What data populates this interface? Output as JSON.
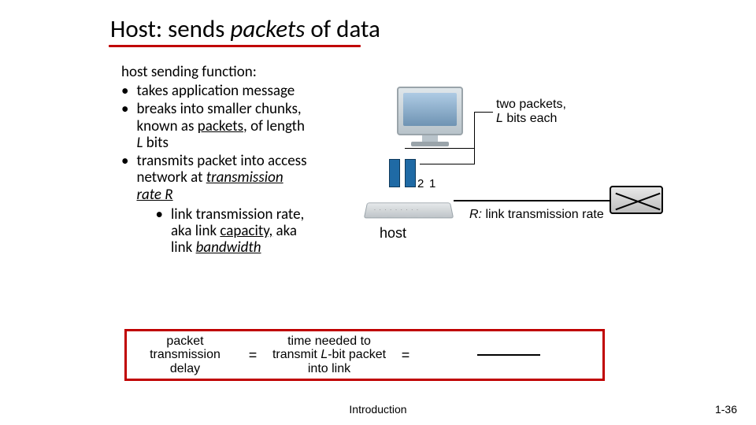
{
  "title": {
    "pre": "Host: sends ",
    "em": "packets",
    "post": " of data"
  },
  "lead": "host sending function:",
  "bullets": {
    "b1": "takes application message",
    "b2_a": "breaks into smaller chunks, known as ",
    "b2_packets": "packets",
    "b2_b": ", of length ",
    "b2_L": "L",
    "b2_c": " bits",
    "b3_a": "transmits packet into access network at ",
    "b3_tr": "transmission rate R",
    "b3_inner_a": "link transmission rate, aka link ",
    "b3_inner_cap": "capacity,",
    "b3_inner_b": " aka link ",
    "b3_inner_bw": "bandwidth"
  },
  "diagram": {
    "pkt2": "2",
    "pkt1": "1",
    "two_line1": "two packets,",
    "two_line2_pre": "",
    "two_line2_L": "L",
    "two_line2_post": " bits each",
    "host": "host",
    "R": "R:",
    "R_text": " link transmission rate"
  },
  "formula": {
    "col1": "packet transmission delay",
    "eq": "=",
    "col2_pre": "time needed to transmit ",
    "col2_L": "L",
    "col2_post": "-bit packet into link"
  },
  "footer": {
    "center": "Introduction",
    "right": "1-36"
  }
}
